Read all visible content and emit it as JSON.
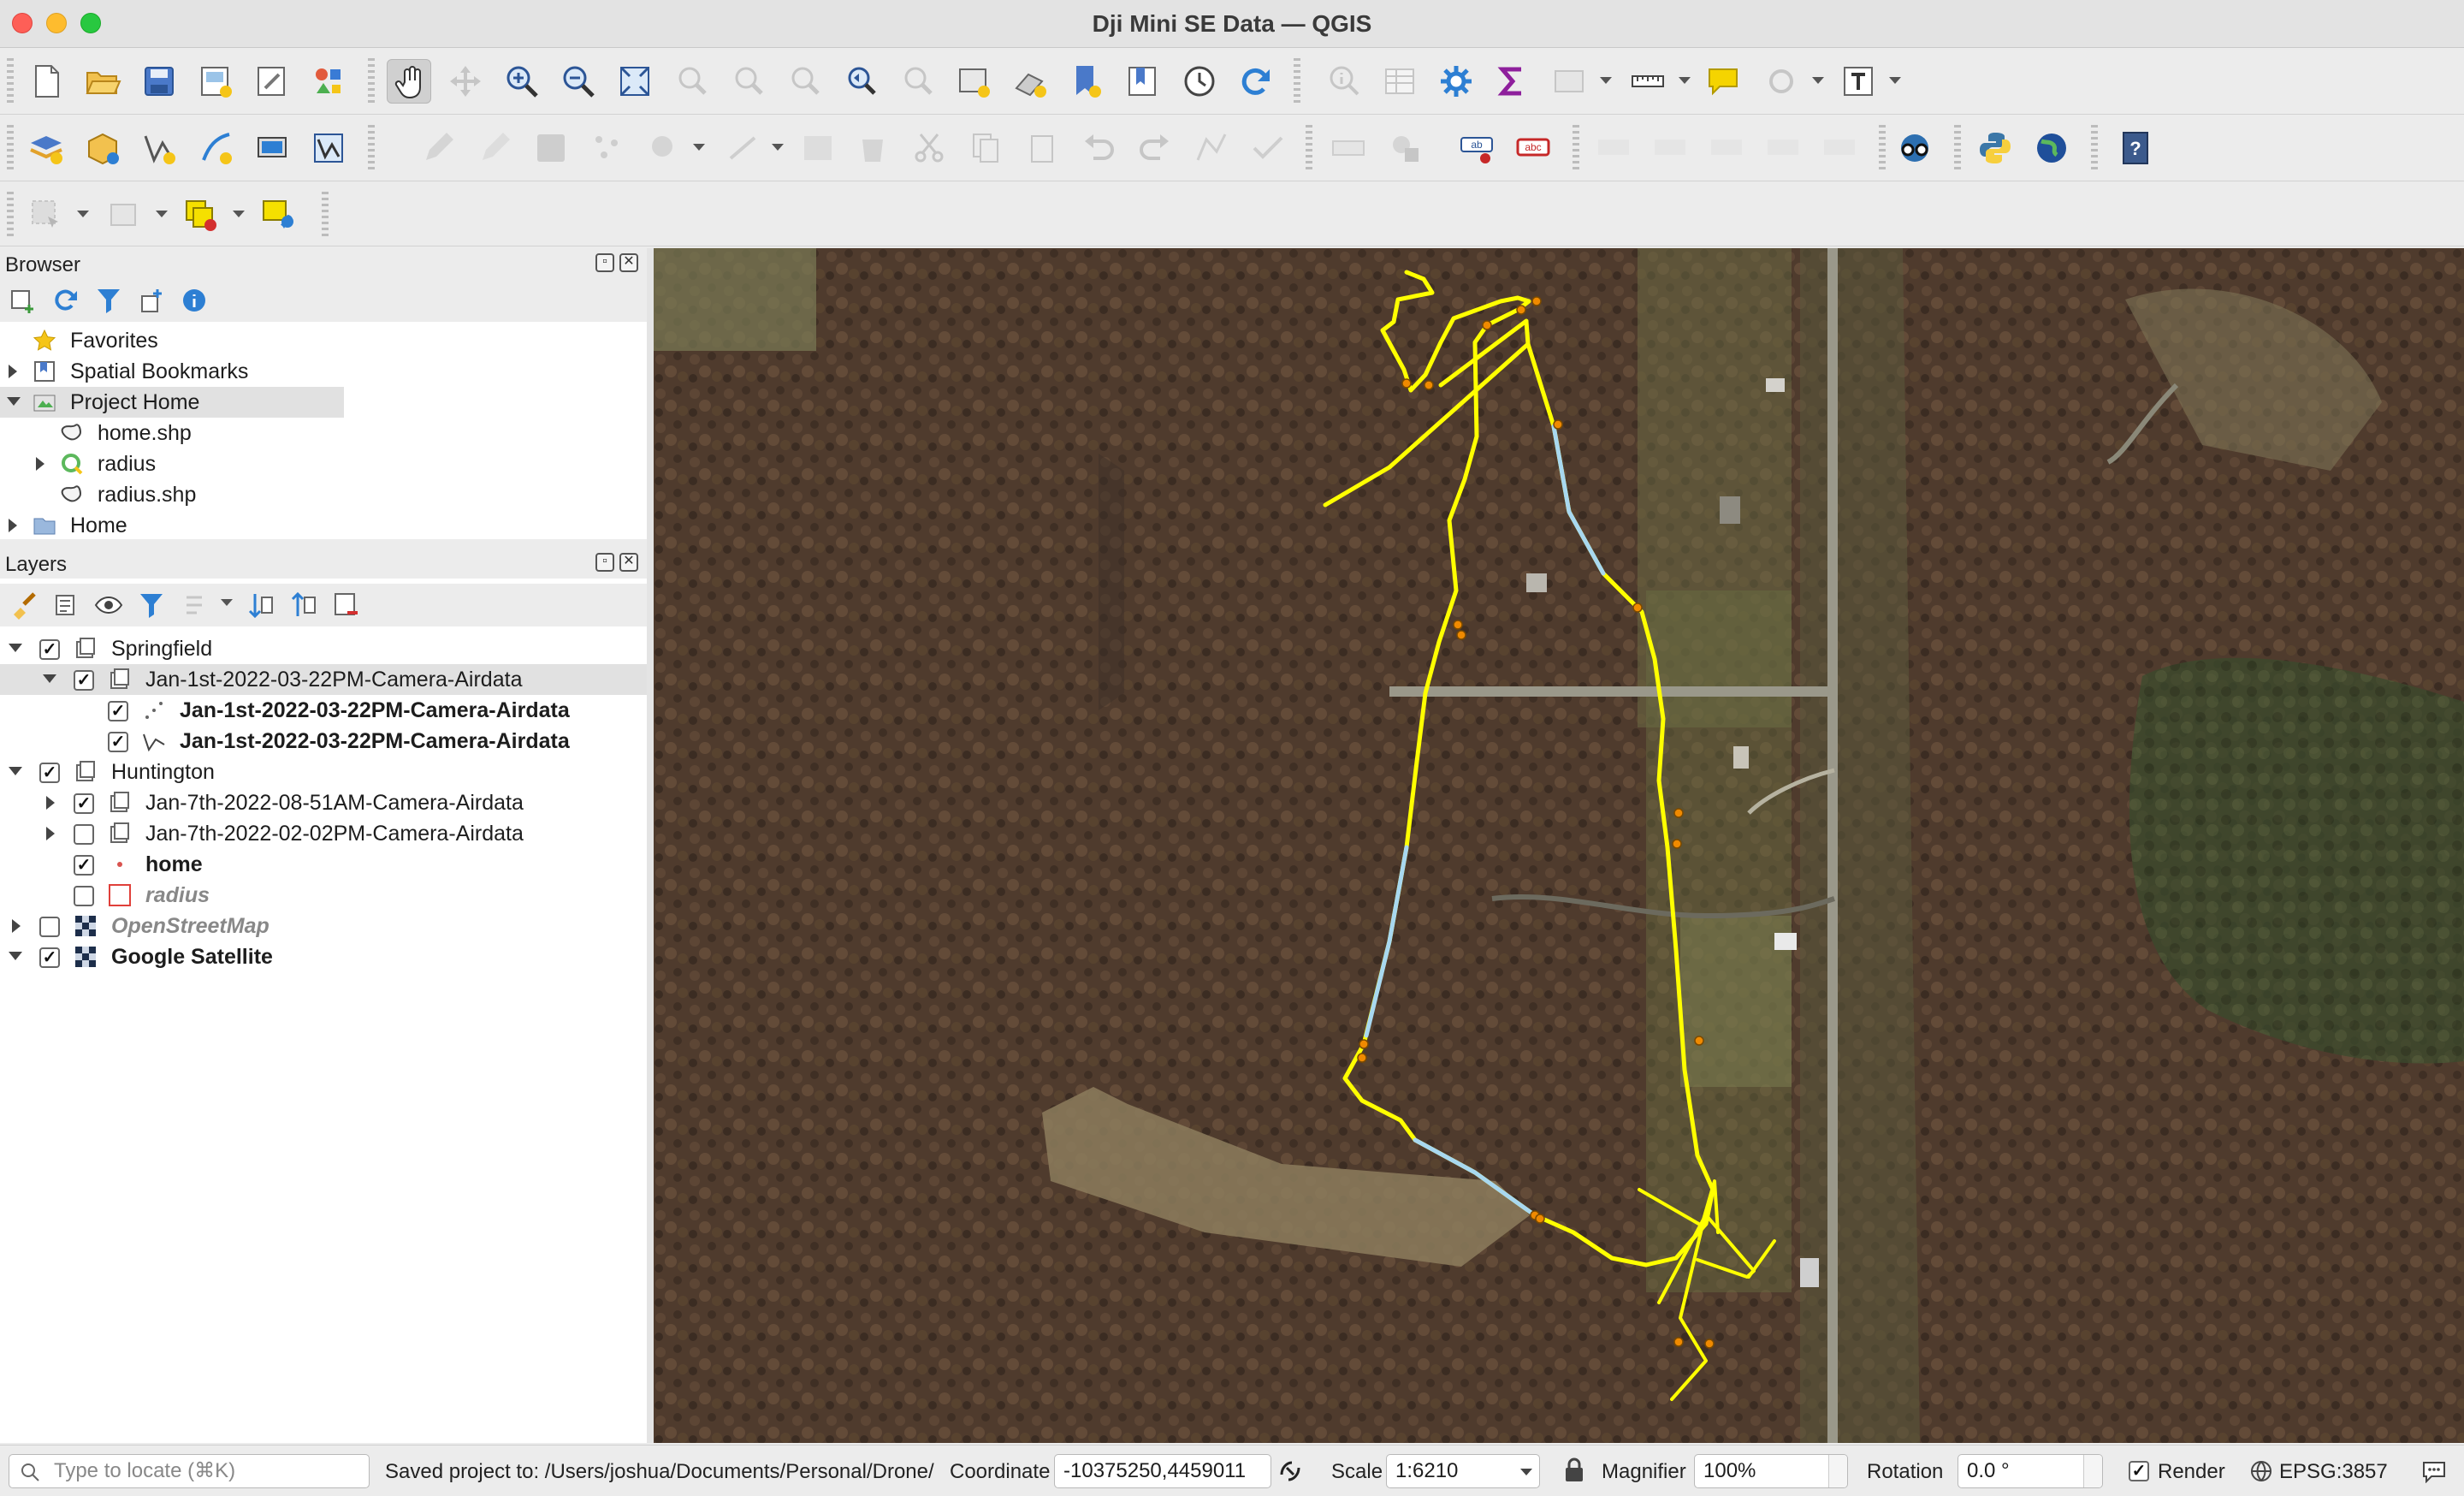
{
  "window": {
    "title": "Dji Mini SE Data — QGIS"
  },
  "toolbars": {
    "row1": [
      "new-project-icon",
      "open-project-icon",
      "save-project-icon",
      "new-print-layout-icon",
      "layout-manager-icon",
      "style-manager-icon",
      "pan-map-icon",
      "pan-to-selection-icon",
      "zoom-in-icon",
      "zoom-out-icon",
      "zoom-full-icon",
      "zoom-to-selection-icon",
      "zoom-to-layer-icon",
      "zoom-native-icon",
      "zoom-last-icon",
      "zoom-next-icon",
      "new-map-view-icon",
      "new-3d-map-view-icon",
      "new-bookmark-icon",
      "show-bookmarks-icon",
      "temporal-controller-icon",
      "refresh-icon",
      "identify-features-icon",
      "open-attribute-table-icon",
      "toolbox-icon",
      "statistical-summary-icon",
      "open-field-calculator-icon",
      "measure-line-icon",
      "map-tips-icon",
      "select-features-icon",
      "text-annotation-icon"
    ],
    "row2": [
      "data-source-manager-icon",
      "new-geopackage-layer-icon",
      "new-shapefile-layer-icon",
      "new-spatialite-layer-icon",
      "new-virtual-layer-icon",
      "new-temporary-layer-icon",
      "current-edits-icon",
      "toggle-editing-icon",
      "save-edits-icon",
      "digitize-icon",
      "add-polygon-icon",
      "vertex-tool-icon",
      "modify-attributes-icon",
      "delete-selected-icon",
      "cut-features-icon",
      "copy-features-icon",
      "paste-features-icon",
      "undo-icon",
      "redo-icon",
      "label-toolbar-icon",
      "layer-diagram-icon",
      "label-pin-icon",
      "label-highlight-icon",
      "show-hide-labels-icon",
      "move-label-icon",
      "rotate-label-icon",
      "change-label-icon",
      "georeferencer-icon",
      "python-console-icon",
      "globe-icon",
      "help-icon"
    ],
    "row3": [
      "select-by-area-icon",
      "deselect-icon",
      "remove-selection-icon",
      "identify-results-icon"
    ]
  },
  "browser": {
    "title": "Browser",
    "items": [
      {
        "label": "Favorites",
        "icon": "star-icon"
      },
      {
        "label": "Spatial Bookmarks",
        "icon": "bookmark-icon"
      },
      {
        "label": "Project Home",
        "icon": "project-folder-icon"
      },
      {
        "label": "home.shp",
        "icon": "vector-file-icon"
      },
      {
        "label": "radius",
        "icon": "qgis-project-icon"
      },
      {
        "label": "radius.shp",
        "icon": "vector-file-icon"
      },
      {
        "label": "Home",
        "icon": "folder-icon"
      }
    ]
  },
  "layers": {
    "title": "Layers",
    "items": [
      {
        "label": "Springfield",
        "checked": true,
        "expanded": true
      },
      {
        "label": "Jan-1st-2022-03-22PM-Camera-Airdata",
        "checked": true,
        "expanded": true,
        "selected": true
      },
      {
        "label": "Jan-1st-2022-03-22PM-Camera-Airdata",
        "checked": true,
        "bold": true,
        "icon": "point-layer-icon"
      },
      {
        "label": "Jan-1st-2022-03-22PM-Camera-Airdata",
        "checked": true,
        "bold": true,
        "icon": "line-layer-icon"
      },
      {
        "label": "Huntington",
        "checked": true,
        "expanded": true
      },
      {
        "label": "Jan-7th-2022-08-51AM-Camera-Airdata",
        "checked": true,
        "expanded": false
      },
      {
        "label": "Jan-7th-2022-02-02PM-Camera-Airdata",
        "checked": false,
        "expanded": false
      },
      {
        "label": "home",
        "checked": true,
        "bold": true
      },
      {
        "label": "radius",
        "checked": false,
        "italic": true
      },
      {
        "label": "OpenStreetMap",
        "checked": false,
        "italic": true,
        "expanded": false
      },
      {
        "label": "Google Satellite",
        "checked": true,
        "bold": true,
        "expanded": true
      }
    ]
  },
  "colors": {
    "track": "#ffff00",
    "track_segment_alt": "#a8d8f0",
    "track_point": "#f08a00",
    "accent": "#2f80ed"
  },
  "statusbar": {
    "locate_placeholder": "Type to locate (⌘K)",
    "message": "Saved project to: /Users/joshua/Documents/Personal/Drone/r",
    "coordinate_label": "Coordinate",
    "coordinate_value": "-10375250,4459011",
    "scale_label": "Scale",
    "scale_value": "1:6210",
    "magnifier_label": "Magnifier",
    "magnifier_value": "100%",
    "rotation_label": "Rotation",
    "rotation_value": "0.0 °",
    "render_label": "Render",
    "crs_label": "EPSG:3857"
  }
}
